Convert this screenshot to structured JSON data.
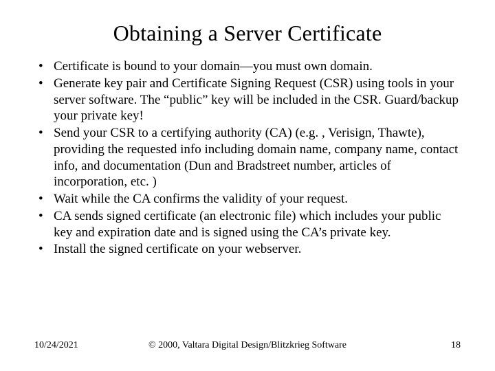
{
  "title": "Obtaining a Server Certificate",
  "bullets": [
    "Certificate is bound to your domain—you must own domain.",
    "Generate key pair and Certificate Signing Request (CSR) using tools in your server software. The “public” key will be included in the CSR. Guard/backup your private key!",
    "Send your CSR to a certifying authority (CA) (e.g. , Verisign, Thawte), providing the requested info including domain name, company name, contact info, and documentation (Dun and Bradstreet number, articles of incorporation, etc. )",
    "Wait while the CA confirms the validity of your request.",
    "CA sends signed certificate (an electronic file) which includes your public key and expiration date and is signed using the CA’s private key.",
    "Install the signed certificate on your webserver."
  ],
  "footer": {
    "date": "10/24/2021",
    "copyright": "© 2000, Valtara Digital Design/Blitzkrieg Software",
    "pagenum": "18"
  }
}
